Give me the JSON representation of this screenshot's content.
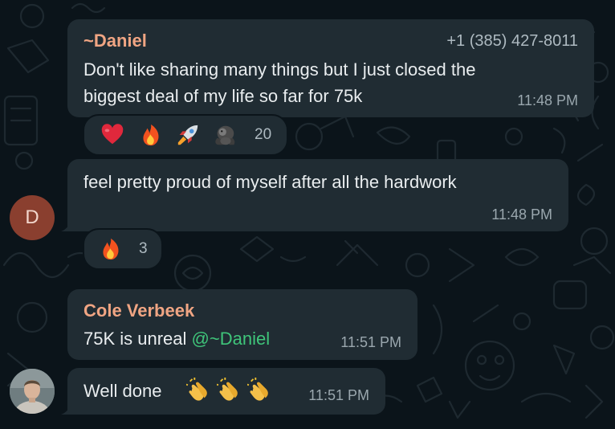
{
  "messages": [
    {
      "sender": "~Daniel",
      "phone": "+1 (385) 427-8011",
      "lines": [
        "Don't like sharing many things but I just closed the",
        "biggest deal of my life so far for 75k"
      ],
      "time": "11:48 PM",
      "reactions": {
        "emojis": [
          "heart",
          "fire",
          "rocket",
          "gorilla"
        ],
        "count": "20"
      }
    },
    {
      "lines": [
        "feel pretty proud of myself after all the hardwork"
      ],
      "time": "11:48 PM",
      "avatar_initial": "D",
      "reactions": {
        "emojis": [
          "fire"
        ],
        "count": "3"
      }
    },
    {
      "sender": "Cole Verbeek",
      "text": "75K is unreal",
      "mention": "@~Daniel",
      "time": "11:51 PM"
    },
    {
      "text": "Well done",
      "emojis": [
        "clapping-hands",
        "clapping-hands",
        "clapping-hands"
      ],
      "time": "11:51 PM"
    }
  ],
  "colors": {
    "background": "#0b141a",
    "bubble": "#202c33",
    "sender_name": "#f0a583",
    "mention": "#3fc57a",
    "avatar_d": "#8a3f2f"
  }
}
